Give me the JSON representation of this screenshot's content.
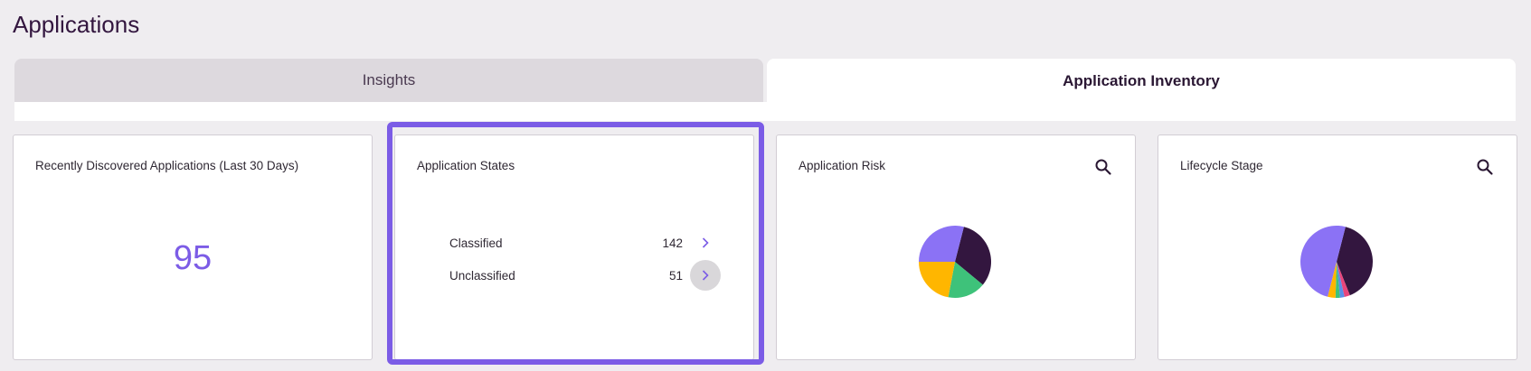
{
  "page": {
    "title": "Applications"
  },
  "tabs": [
    {
      "label": "Insights",
      "active": false
    },
    {
      "label": "Application Inventory",
      "active": true
    }
  ],
  "cards": {
    "recent": {
      "title": "Recently Discovered Applications (Last 30 Days)",
      "value": "95"
    },
    "states": {
      "title": "Application States",
      "rows": [
        {
          "label": "Classified",
          "count": "142"
        },
        {
          "label": "Unclassified",
          "count": "51"
        }
      ]
    },
    "risk": {
      "title": "Application Risk"
    },
    "lifecycle": {
      "title": "Lifecycle Stage"
    }
  },
  "colors": {
    "accent": "#7b5ce6",
    "dark": "#33163f",
    "green": "#3ec27a",
    "yellow": "#ffb600",
    "purple": "#8b72f5"
  },
  "icons": {
    "search": "search-icon",
    "chevron": "chevron-right-icon"
  },
  "chart_data": [
    {
      "type": "pie",
      "slices": [
        {
          "value": 32,
          "color": "#33163f"
        },
        {
          "value": 17,
          "color": "#3ec27a"
        },
        {
          "value": 22,
          "color": "#ffb600"
        },
        {
          "value": 29,
          "color": "#8b72f5"
        }
      ]
    },
    {
      "type": "pie",
      "slices": [
        {
          "value": 40,
          "color": "#33163f"
        },
        {
          "value": 2.5,
          "color": "#e8457b"
        },
        {
          "value": 2,
          "color": "#5a8ee8"
        },
        {
          "value": 2,
          "color": "#3ec27a"
        },
        {
          "value": 3.5,
          "color": "#ffb600"
        },
        {
          "value": 50,
          "color": "#8b72f5"
        }
      ]
    }
  ]
}
